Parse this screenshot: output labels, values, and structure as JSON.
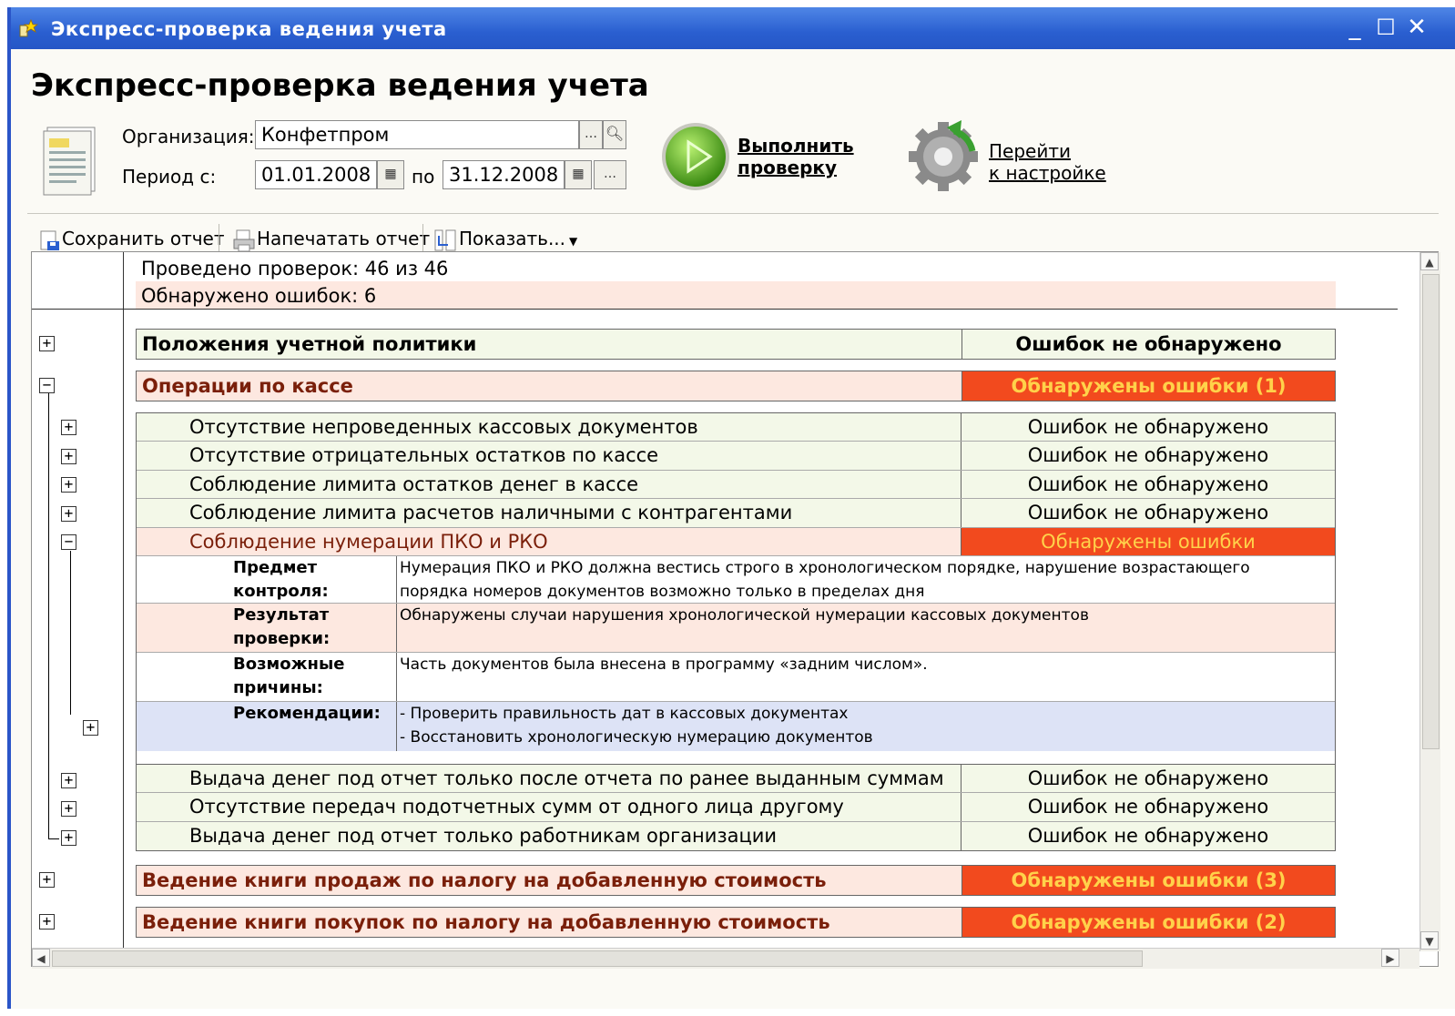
{
  "window": {
    "title": "Экспресс-проверка ведения учета"
  },
  "page": {
    "title": "Экспресс-проверка ведения учета"
  },
  "form": {
    "org_label": "Организация:",
    "org_value": "Конфетпром",
    "period_label": "Период с:",
    "date_from": "01.01.2008",
    "to_label": "по",
    "date_to": "31.12.2008"
  },
  "actions": {
    "run_line1": "Выполнить",
    "run_line2": "проверку",
    "settings_line1": "Перейти",
    "settings_line2": "к настройке"
  },
  "toolbar": {
    "save": "Сохранить отчет",
    "print": "Напечатать отчет",
    "show": "Показать..."
  },
  "summary": {
    "checks": "Проведено проверок: 46 из 46",
    "errors": "Обнаружено ошибок: 6"
  },
  "groups": [
    {
      "title": "Положения учетной политики",
      "status": "Ошибок не обнаружено"
    },
    {
      "title": "Операции по кассе",
      "status": "Обнаружены ошибки (1)"
    },
    {
      "title": "Ведение книги продаж по налогу на добавленную стоимость",
      "status": "Обнаружены ошибки (3)"
    },
    {
      "title": "Ведение книги покупок по налогу на добавленную стоимость",
      "status": "Обнаружены ошибки (2)"
    }
  ],
  "cash_items": [
    {
      "title": "Отсутствие непроведенных кассовых документов",
      "status": "Ошибок не обнаружено"
    },
    {
      "title": "Отсутствие отрицательных остатков по кассе",
      "status": "Ошибок не обнаружено"
    },
    {
      "title": "Соблюдение лимита остатков денег в кассе",
      "status": "Ошибок не обнаружено"
    },
    {
      "title": "Соблюдение лимита расчетов наличными с контрагентами",
      "status": "Ошибок не обнаружено"
    },
    {
      "title": "Соблюдение нумерации ПКО и РКО",
      "status": "Обнаружены ошибки"
    },
    {
      "title": "Выдача денег под отчет только после отчета по ранее выданным суммам",
      "status": "Ошибок не обнаружено"
    },
    {
      "title": "Отсутствие передач подотчетных сумм от одного лица другому",
      "status": "Ошибок не обнаружено"
    },
    {
      "title": "Выдача денег под отчет только работникам организации",
      "status": "Ошибок не обнаружено"
    }
  ],
  "details": {
    "subject_key_1": "Предмет",
    "subject_key_2": "контроля:",
    "subject_val_1": "Нумерация ПКО и РКО должна вестись строго в хронологическом порядке, нарушение возрастающего",
    "subject_val_2": "порядка номеров документов возможно только в пределах дня",
    "result_key_1": "Результат",
    "result_key_2": "проверки:",
    "result_val": "Обнаружены случаи нарушения хронологической нумерации кассовых документов",
    "causes_key_1": "Возможные",
    "causes_key_2": "причины:",
    "causes_val": "Часть документов была внесена в программу «задним числом».",
    "rec_key": "Рекомендации:",
    "rec_val_1": "- Проверить правильность дат в кассовых документах",
    "rec_val_2": "- Восстановить хронологическую нумерацию документов"
  },
  "colors": {
    "ok_bg": "#f3f8e8",
    "err_row_bg": "#fde8e0",
    "err_status_bg": "#f24a1e",
    "err_text": "#7a1f0a",
    "err_status_text": "#ffd24a",
    "rec_bg": "#dde3f6"
  }
}
